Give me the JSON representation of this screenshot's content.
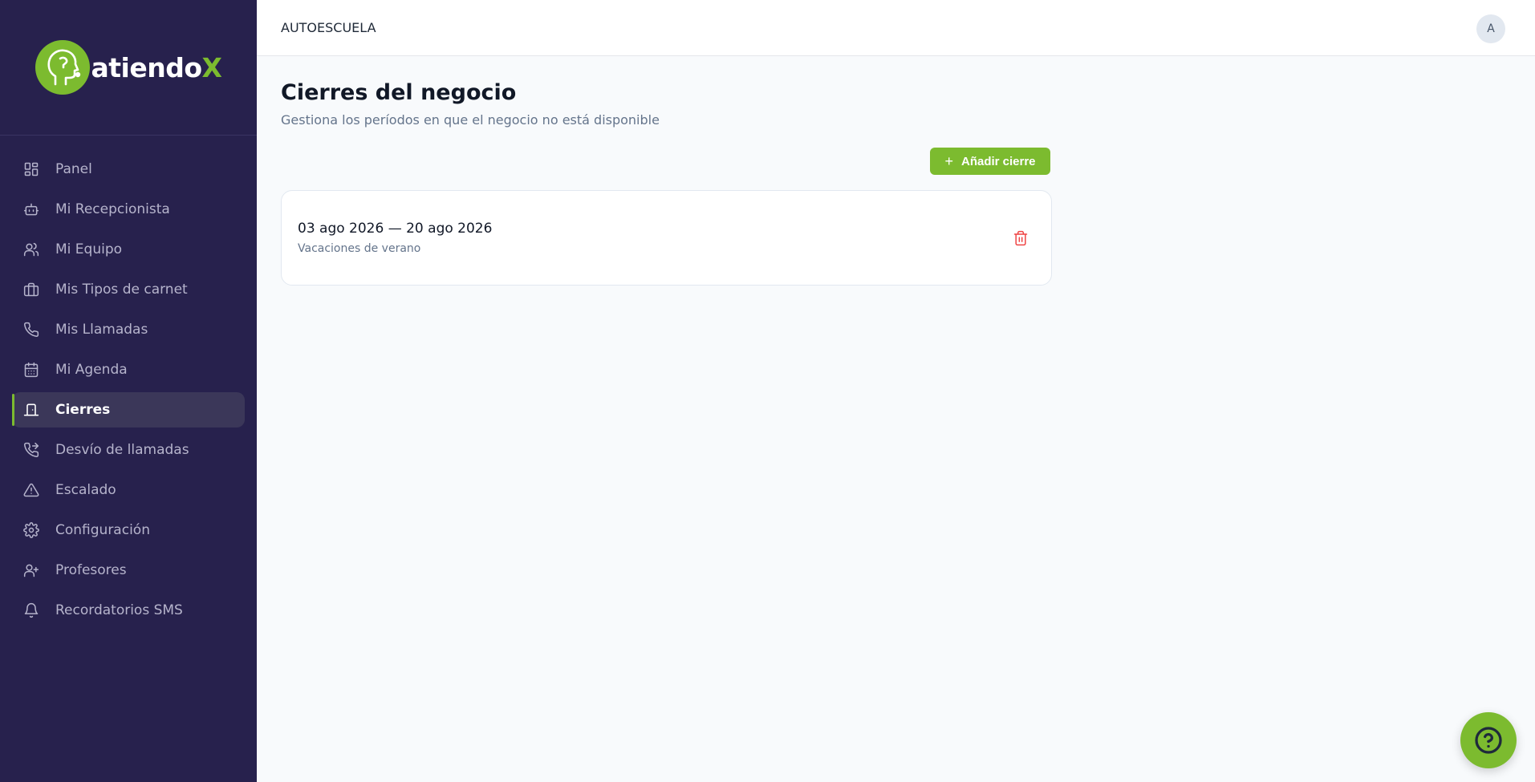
{
  "brand": {
    "name_main": "atiendo",
    "name_accent": "X",
    "accent_color": "#7cbb2f",
    "sidebar_color": "#27214d"
  },
  "header": {
    "company_name": "AUTOESCUELA",
    "avatar_initial": "A"
  },
  "sidebar": {
    "items": [
      {
        "label": "Panel",
        "icon": "dashboard-grid-icon"
      },
      {
        "label": "Mi Recepcionista",
        "icon": "bot-icon"
      },
      {
        "label": "Mi Equipo",
        "icon": "users-icon"
      },
      {
        "label": "Mis Tipos de carnet",
        "icon": "briefcase-icon"
      },
      {
        "label": "Mis Llamadas",
        "icon": "phone-icon"
      },
      {
        "label": "Mi Agenda",
        "icon": "calendar-icon"
      },
      {
        "label": "Cierres",
        "icon": "door-closed-icon",
        "active": true
      },
      {
        "label": "Desvío de llamadas",
        "icon": "phone-forward-icon"
      },
      {
        "label": "Escalado",
        "icon": "alert-triangle-icon"
      },
      {
        "label": "Configuración",
        "icon": "gear-icon"
      },
      {
        "label": "Profesores",
        "icon": "user-plus-icon"
      },
      {
        "label": "Recordatorios SMS",
        "icon": "bell-icon"
      }
    ]
  },
  "main": {
    "title": "Cierres del negocio",
    "subtitle": "Gestiona los períodos en que el negocio no está disponible",
    "add_button_label": "Añadir cierre",
    "closures": [
      {
        "dates": "03 ago 2026 — 20 ago 2026",
        "reason": "Vacaciones de verano"
      }
    ]
  },
  "help_button": {
    "icon": "help-circle-icon"
  }
}
